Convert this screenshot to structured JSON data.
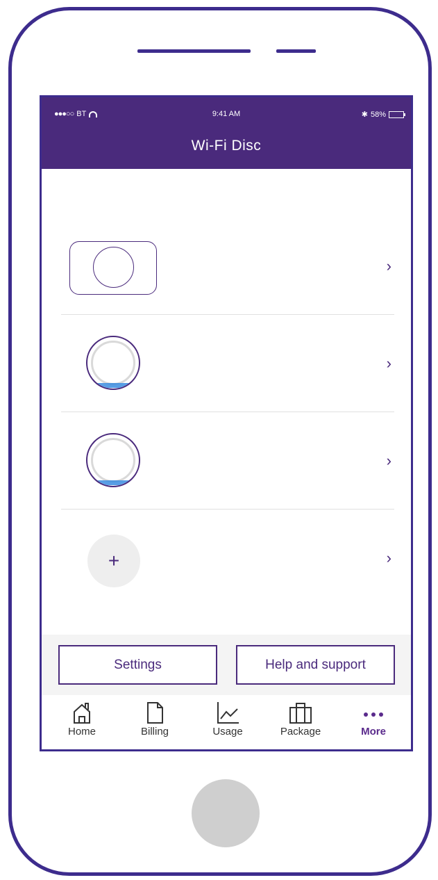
{
  "status_bar": {
    "carrier": "BT",
    "time": "9:41 AM",
    "battery": "58%"
  },
  "header": {
    "title": "Wi-Fi Disc"
  },
  "devices": [
    {
      "type": "hub-icon"
    },
    {
      "type": "disc-icon"
    },
    {
      "type": "disc-icon"
    },
    {
      "type": "add-icon"
    }
  ],
  "actions": {
    "settings_label": "Settings",
    "help_label": "Help and support"
  },
  "tabs": [
    {
      "label": "Home",
      "icon": "home-icon"
    },
    {
      "label": "Billing",
      "icon": "document-icon"
    },
    {
      "label": "Usage",
      "icon": "chart-icon"
    },
    {
      "label": "Package",
      "icon": "briefcase-icon"
    },
    {
      "label": "More",
      "icon": "more-dots-icon",
      "active": true
    }
  ],
  "colors": {
    "brand_purple": "#4a2a7c",
    "frame": "#3d2c8d",
    "disc_glow": "#2e86de"
  }
}
